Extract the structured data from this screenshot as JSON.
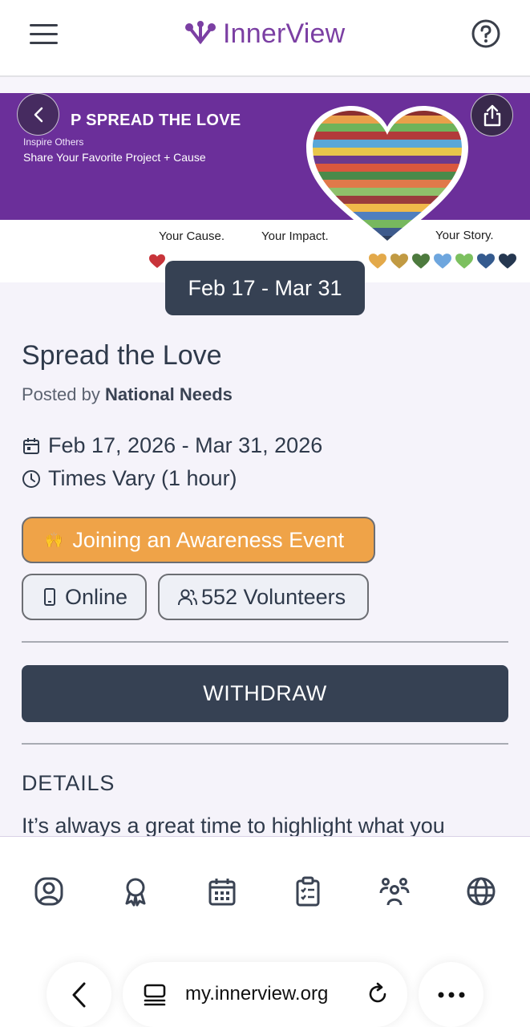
{
  "header": {
    "brand": "InnerView",
    "brand_color": "#7b3fa3"
  },
  "banner": {
    "title": "P SPREAD THE LOVE",
    "subtitle1": "Inspire Others",
    "subtitle2": "Share Your Favorite Project + Cause",
    "caption_cause": "Your Cause.",
    "caption_impact": "Your Impact.",
    "caption_story": "Your Story."
  },
  "event": {
    "date_pill": "Feb 17 - Mar 31",
    "title": "Spread the Love",
    "posted_prefix": "Posted by",
    "posted_by": "National Needs",
    "date_range": "Feb 17, 2026 - Mar 31, 2026",
    "times": "Times Vary (1 hour)",
    "tags": {
      "primary": "Joining an Awareness Event",
      "primary_emoji": "🙌",
      "location": "Online",
      "volunteers": "552 Volunteers"
    },
    "withdraw_label": "WITHDRAW",
    "details_heading": "DETAILS",
    "details_text": "It’s always a great time to highlight what you"
  },
  "bottom_nav": {
    "items": [
      "profile-icon",
      "award-icon",
      "calendar-icon",
      "clipboard-icon",
      "community-icon",
      "globe-icon"
    ]
  },
  "browser": {
    "url": "my.innerview.org"
  },
  "colors": {
    "accent_orange": "#efa348",
    "dark_slate": "#364153",
    "banner_purple": "#6b2f9a"
  }
}
